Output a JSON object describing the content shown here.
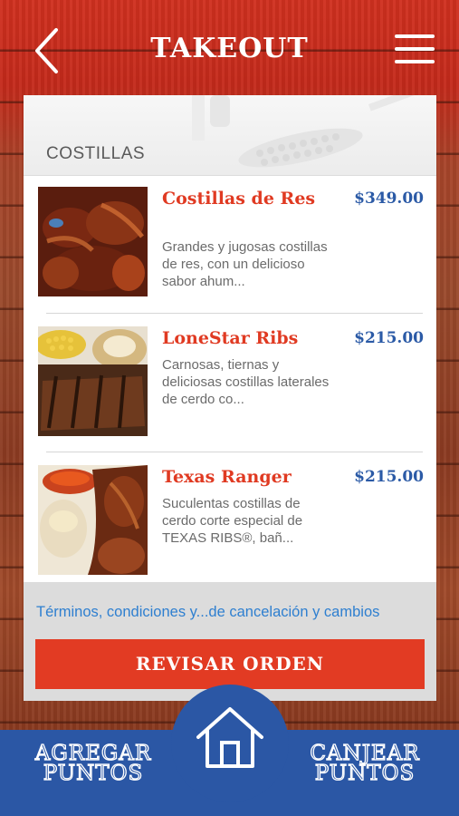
{
  "header": {
    "title": "TAKEOUT"
  },
  "section": {
    "title": "COSTILLAS"
  },
  "items": [
    {
      "name": "Costillas de Res",
      "price": "$349.00",
      "description": "Grandes y jugosas costillas de res, con un delicioso sabor ahum..."
    },
    {
      "name": "LoneStar Ribs",
      "price": "$215.00",
      "description": "Carnosas, tiernas y deliciosas costillas laterales de cerdo co..."
    },
    {
      "name": "Texas Ranger",
      "price": "$215.00",
      "description": "Suculentas costillas de cerdo corte especial de TEXAS RIBS®, bañ..."
    }
  ],
  "footer": {
    "terms_link": "Términos, condiciones y...de cancelación y cambios",
    "review_button": "REVISAR ORDEN"
  },
  "bottom_nav": {
    "left_label": "AGREGAR PUNTOS",
    "right_label": "CANJEAR PUNTOS"
  },
  "colors": {
    "accent_red": "#e23b23",
    "price_blue": "#2b5aa6",
    "nav_blue": "#2b57a5",
    "link_blue": "#2e7fd0"
  }
}
